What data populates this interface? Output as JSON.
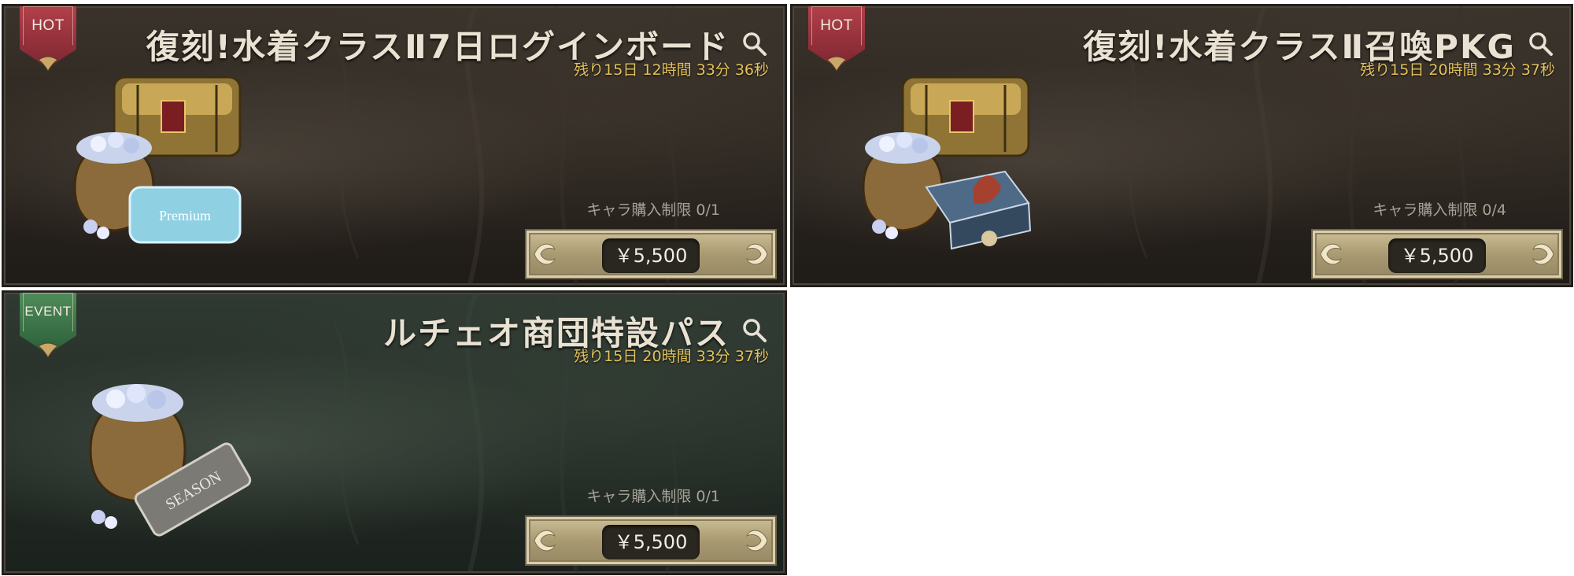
{
  "cards": [
    {
      "badge": "HOT",
      "title": "復刻!水着クラスⅡ7日ログインボード",
      "timer": "残り15日 12時間 33分 36秒",
      "limit": "キャラ購入制限 0/1",
      "price": "￥5,500",
      "art_label": "Premium",
      "theme": "hot"
    },
    {
      "badge": "HOT",
      "title": "復刻!水着クラスⅡ召喚PKG",
      "timer": "残り15日 20時間 33分 37秒",
      "limit": "キャラ購入制限 0/4",
      "price": "￥5,500",
      "theme": "hot"
    },
    {
      "badge": "EVENT",
      "title": "ルチェオ商団特設パス",
      "timer": "残り15日 20時間 33分 37秒",
      "limit": "キャラ購入制限 0/1",
      "price": "￥5,500",
      "art_label": "SEASON",
      "theme": "event"
    }
  ],
  "colors": {
    "hot_badge": "#9e3440",
    "event_badge": "#3f7a4b",
    "timer": "#e4c25d",
    "title": "#e9e1d2",
    "button": "#b8aa82"
  },
  "icons": {
    "search": "search-icon",
    "chest": "treasure-chest-icon",
    "gem_bag": "gem-bag-icon"
  }
}
